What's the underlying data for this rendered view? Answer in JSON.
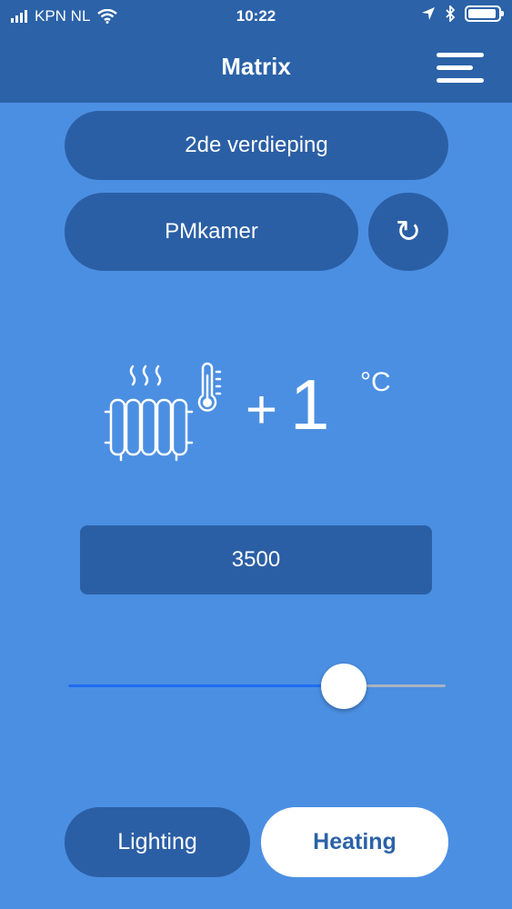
{
  "status_bar": {
    "carrier": "KPN NL",
    "time": "10:22",
    "signal_bars": 4,
    "battery_level": 0.9
  },
  "navbar": {
    "title": "Matrix",
    "menu_icon": "hamburger-menu-icon"
  },
  "selectors": {
    "floor": "2de verdieping",
    "room": "PMkamer",
    "refresh_glyph": "↻"
  },
  "heating": {
    "icon": "radiator-thermometer-icon",
    "sign": "+",
    "offset": "1",
    "unit": "°C"
  },
  "value_box": "3500",
  "slider": {
    "value_fraction": 0.73
  },
  "tabs": {
    "lighting": "Lighting",
    "heating": "Heating",
    "active": "heating"
  },
  "colors": {
    "background": "#4b8fe2",
    "bar": "#2b62a8",
    "button": "#2b5fa5",
    "slider_active": "#1f6cf2"
  }
}
